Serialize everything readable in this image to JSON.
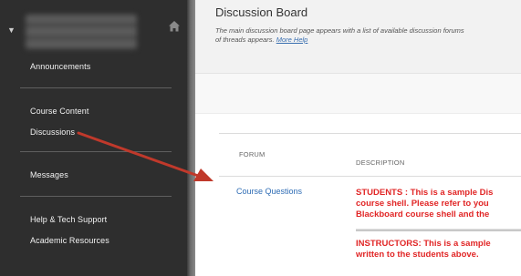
{
  "sidebar": {
    "collapse_icon": "caret-down-icon",
    "home_icon": "home-icon",
    "items": [
      {
        "label": "Announcements"
      },
      {
        "label": "Course Content"
      },
      {
        "label": "Discussions"
      },
      {
        "label": "Messages"
      },
      {
        "label": "Help & Tech Support"
      },
      {
        "label": "Academic Resources"
      }
    ]
  },
  "main": {
    "title": "Discussion Board",
    "description_line1": "The main discussion board page appears with a list of available discussion forums",
    "description_line2": "of threads appears.",
    "help_link": "More Help",
    "table": {
      "columns": [
        "FORUM",
        "DESCRIPTION"
      ],
      "rows": [
        {
          "forum": "Course Questions",
          "desc_students": [
            "STUDENTS : This is a sample Dis",
            "course shell. Please refer to you",
            "Blackboard course shell and the"
          ],
          "desc_instructors": [
            "INSTRUCTORS: This is a sample",
            "written to the students above."
          ]
        }
      ]
    }
  },
  "annotation": {
    "type": "arrow",
    "color": "#c0392b"
  },
  "colors": {
    "sidebar_bg": "#2e2e2e",
    "link": "#2f6db5",
    "warning_text": "#e12626"
  }
}
